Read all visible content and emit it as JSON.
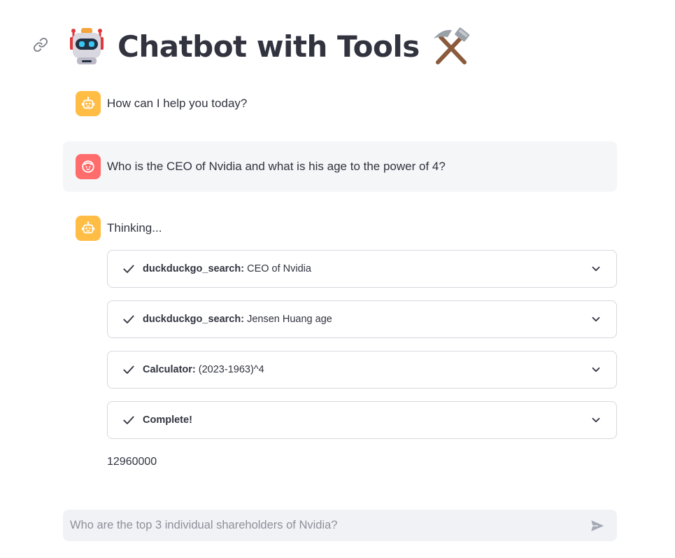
{
  "header": {
    "title": "Chatbot with Tools",
    "link_icon": "link-icon",
    "robot_icon": "robot-face-emoji",
    "tools_icon": "hammer-and-pick-emoji"
  },
  "messages": [
    {
      "role": "assistant",
      "avatar_icon": "bot-face-icon",
      "text": "How can I help you today?"
    },
    {
      "role": "user",
      "avatar_icon": "smiley-face-icon",
      "text": "Who is the CEO of Nvidia and what is his age to the power of 4?"
    },
    {
      "role": "assistant",
      "avatar_icon": "bot-face-icon",
      "text": "Thinking..."
    }
  ],
  "tool_steps": [
    {
      "status_icon": "check-icon",
      "tool": "duckduckgo_search:",
      "query": "CEO of Nvidia",
      "expander_icon": "chevron-down-icon"
    },
    {
      "status_icon": "check-icon",
      "tool": "duckduckgo_search:",
      "query": "Jensen Huang age",
      "expander_icon": "chevron-down-icon"
    },
    {
      "status_icon": "check-icon",
      "tool": "Calculator:",
      "query": "(2023-1963)^4",
      "expander_icon": "chevron-down-icon"
    },
    {
      "status_icon": "check-icon",
      "tool": "Complete!",
      "query": "",
      "expander_icon": "chevron-down-icon"
    }
  ],
  "answer": "12960000",
  "chat_input": {
    "placeholder": "Who are the top 3 individual shareholders of Nvidia?",
    "value": "",
    "send_icon": "send-icon"
  },
  "colors": {
    "bot_avatar": "#ffbd45",
    "user_avatar": "#ff6c6c",
    "user_message_bg": "#f5f6f8",
    "input_bg": "#f0f2f6",
    "text": "#31333f"
  }
}
